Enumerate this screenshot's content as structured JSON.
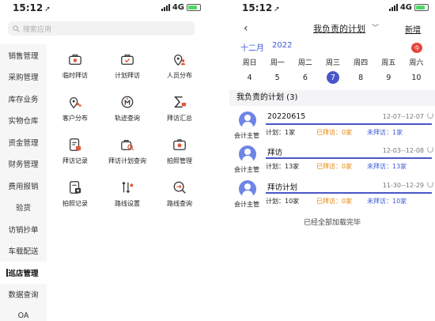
{
  "left": {
    "status": {
      "time": "15:12",
      "network": "4G"
    },
    "search": {
      "placeholder": "搜索应用"
    },
    "sidebar": {
      "items": [
        {
          "label": "销售管理",
          "active": false
        },
        {
          "label": "采购管理",
          "active": false
        },
        {
          "label": "库存业务",
          "active": false
        },
        {
          "label": "实物仓库",
          "active": false
        },
        {
          "label": "资金管理",
          "active": false
        },
        {
          "label": "财务管理",
          "active": false
        },
        {
          "label": "费用报销",
          "active": false
        },
        {
          "label": "验货",
          "active": false
        },
        {
          "label": "访销抄单",
          "active": false
        },
        {
          "label": "车载配送",
          "active": false
        },
        {
          "label": "巡店管理",
          "active": true
        },
        {
          "label": "数据查询",
          "active": false
        },
        {
          "label": "OA",
          "active": false
        }
      ]
    },
    "apps": [
      {
        "label": "临时拜访",
        "icon": "bag-icon"
      },
      {
        "label": "计划拜访",
        "icon": "briefcase-check-icon"
      },
      {
        "label": "人员分布",
        "icon": "pin-people-icon"
      },
      {
        "label": "客户分布",
        "icon": "pin-group-icon"
      },
      {
        "label": "轨迹查询",
        "icon": "track-icon"
      },
      {
        "label": "拜访汇总",
        "icon": "sigma-icon"
      },
      {
        "label": "拜访记录",
        "icon": "record-icon"
      },
      {
        "label": "拜访计划查询",
        "icon": "plan-search-icon"
      },
      {
        "label": "拍照管理",
        "icon": "camera-icon"
      },
      {
        "label": "拍照记录",
        "icon": "photo-record-icon"
      },
      {
        "label": "路线设置",
        "icon": "route-setting-icon"
      },
      {
        "label": "路线查询",
        "icon": "route-search-icon"
      }
    ]
  },
  "right": {
    "status": {
      "time": "15:12",
      "network": "4G"
    },
    "nav": {
      "back": "‹",
      "title": "我负责的计划",
      "add": "新增"
    },
    "calendar": {
      "month": "十二月",
      "year": "2022",
      "today_badge": "今",
      "weekdays": [
        "周日",
        "周一",
        "周二",
        "周三",
        "周四",
        "周五",
        "周六"
      ],
      "days": [
        "4",
        "5",
        "6",
        "7",
        "8",
        "9",
        "10"
      ],
      "selected_index": 3
    },
    "section_title": "我负责的计划 (3)",
    "plans": [
      {
        "title": "20220615",
        "date": "12-07--12-07",
        "role": "会计主管",
        "plan": "计划：1家",
        "visited": "已拜访：0家",
        "unvisited": "未拜访：1家"
      },
      {
        "title": "拜访",
        "date": "12-03--12-08",
        "role": "会计主管",
        "plan": "计划：13家",
        "visited": "已拜访：0家",
        "unvisited": "未拜访：13家"
      },
      {
        "title": "拜访计划",
        "date": "11-30--12-29",
        "role": "会计主管",
        "plan": "计划：10家",
        "visited": "已拜访：0家",
        "unvisited": "未拜访：10家"
      }
    ],
    "footer": "已经全部加载完毕"
  },
  "colors": {
    "accent": "#4a56c8",
    "orange": "#e8860e",
    "blue_text": "#3b5bd6",
    "badge": "#e9443a",
    "icon_red": "#e05a3a"
  }
}
